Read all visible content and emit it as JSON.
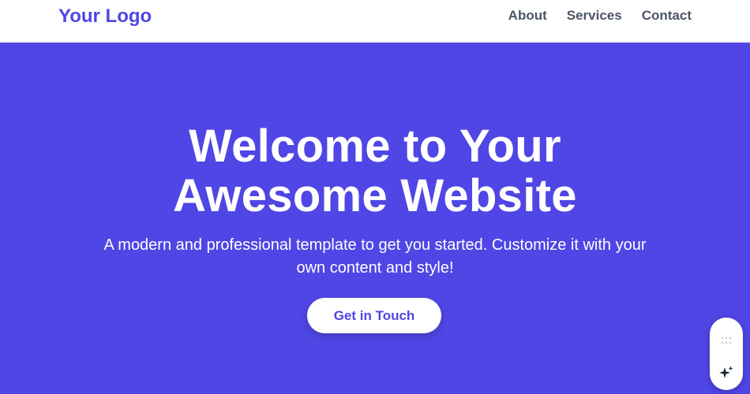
{
  "header": {
    "logo": "Your Logo",
    "nav": [
      {
        "label": "About"
      },
      {
        "label": "Services"
      },
      {
        "label": "Contact"
      }
    ]
  },
  "hero": {
    "title_line1": "Welcome to Your",
    "title_line2": "Awesome Website",
    "subtitle": "A modern and professional template to get you started. Customize it with your own content and style!",
    "cta_label": "Get in Touch"
  },
  "widget": {
    "icons": [
      "drag-grip-icon",
      "sparkle-icon"
    ]
  },
  "colors": {
    "brand": "#4f46e5",
    "nav_text": "#4b5563",
    "hero_text": "#ffffff",
    "button_bg": "#ffffff"
  }
}
